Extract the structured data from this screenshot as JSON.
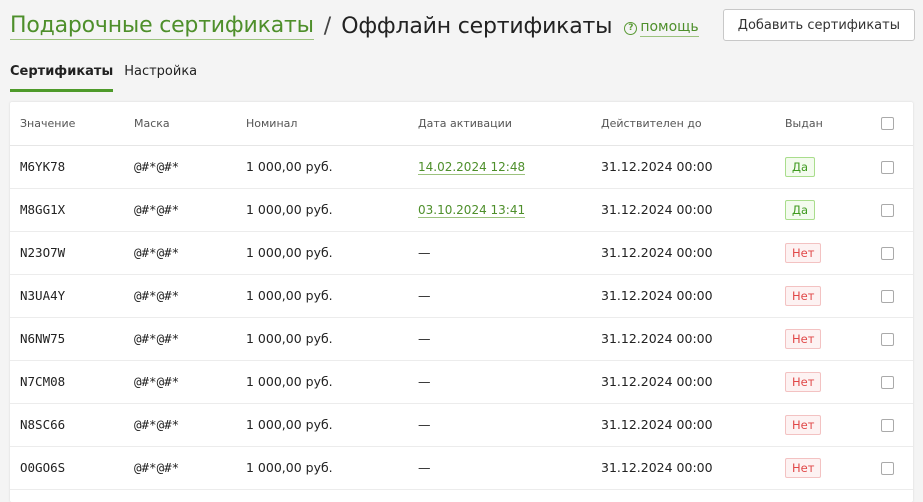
{
  "header": {
    "breadcrumb_link": "Подарочные сертификаты",
    "separator": "/",
    "title": "Оффлайн сертификаты",
    "help_icon_text": "?",
    "help_label": "помощь",
    "add_button": "Добавить сертификаты"
  },
  "tabs": [
    {
      "label": "Сертификаты",
      "active": true
    },
    {
      "label": "Настройка",
      "active": false
    }
  ],
  "table": {
    "columns": [
      "Значение",
      "Маска",
      "Номинал",
      "Дата активации",
      "Действителен до",
      "Выдан"
    ],
    "rows": [
      {
        "value": "M6YK78",
        "mask": "@#*@#*",
        "nominal": "1 000,00 руб.",
        "activated": "14.02.2024 12:48",
        "valid_until": "31.12.2024 00:00",
        "issued": "Да",
        "issued_flag": true
      },
      {
        "value": "M8GG1X",
        "mask": "@#*@#*",
        "nominal": "1 000,00 руб.",
        "activated": "03.10.2024 13:41",
        "valid_until": "31.12.2024 00:00",
        "issued": "Да",
        "issued_flag": true
      },
      {
        "value": "N23O7W",
        "mask": "@#*@#*",
        "nominal": "1 000,00 руб.",
        "activated": "—",
        "valid_until": "31.12.2024 00:00",
        "issued": "Нет",
        "issued_flag": false
      },
      {
        "value": "N3UA4Y",
        "mask": "@#*@#*",
        "nominal": "1 000,00 руб.",
        "activated": "—",
        "valid_until": "31.12.2024 00:00",
        "issued": "Нет",
        "issued_flag": false
      },
      {
        "value": "N6NW75",
        "mask": "@#*@#*",
        "nominal": "1 000,00 руб.",
        "activated": "—",
        "valid_until": "31.12.2024 00:00",
        "issued": "Нет",
        "issued_flag": false
      },
      {
        "value": "N7CM08",
        "mask": "@#*@#*",
        "nominal": "1 000,00 руб.",
        "activated": "—",
        "valid_until": "31.12.2024 00:00",
        "issued": "Нет",
        "issued_flag": false
      },
      {
        "value": "N8SC66",
        "mask": "@#*@#*",
        "nominal": "1 000,00 руб.",
        "activated": "—",
        "valid_until": "31.12.2024 00:00",
        "issued": "Нет",
        "issued_flag": false
      },
      {
        "value": "O0GO6S",
        "mask": "@#*@#*",
        "nominal": "1 000,00 руб.",
        "activated": "—",
        "valid_until": "31.12.2024 00:00",
        "issued": "Нет",
        "issued_flag": false
      }
    ]
  },
  "colors": {
    "accent_green": "#4e8f2b",
    "badge_yes": "#3f9a1f",
    "badge_no": "#e04848"
  }
}
